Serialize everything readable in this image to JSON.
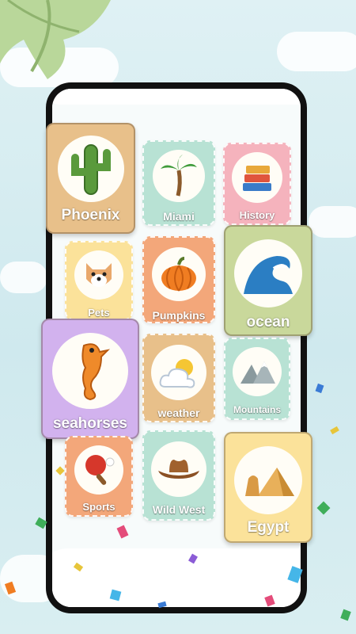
{
  "cards": [
    {
      "label": "Phoenix",
      "icon": "cactus-icon",
      "color": "#e8c08a"
    },
    {
      "label": "Miami",
      "icon": "palm-tree-icon",
      "color": "#b8e2d4"
    },
    {
      "label": "History",
      "icon": "books-icon",
      "color": "#f5b3bd"
    },
    {
      "label": "Pets",
      "icon": "dog-icon",
      "color": "#fbe29a"
    },
    {
      "label": "Pumpkins",
      "icon": "pumpkin-icon",
      "color": "#f3a77a"
    },
    {
      "label": "ocean",
      "icon": "wave-icon",
      "color": "#c9d89b"
    },
    {
      "label": "seahorses",
      "icon": "seahorse-icon",
      "color": "#d2b2ee"
    },
    {
      "label": "weather",
      "icon": "cloud-sun-icon",
      "color": "#e8c08a"
    },
    {
      "label": "Mountains",
      "icon": "mountains-icon",
      "color": "#b8e2d4"
    },
    {
      "label": "Sports",
      "icon": "ping-pong-icon",
      "color": "#f3a77a"
    },
    {
      "label": "Wild West",
      "icon": "cowboy-hat-icon",
      "color": "#b8e2d4"
    },
    {
      "label": "Egypt",
      "icon": "pyramid-icon",
      "color": "#fbe29a"
    }
  ]
}
